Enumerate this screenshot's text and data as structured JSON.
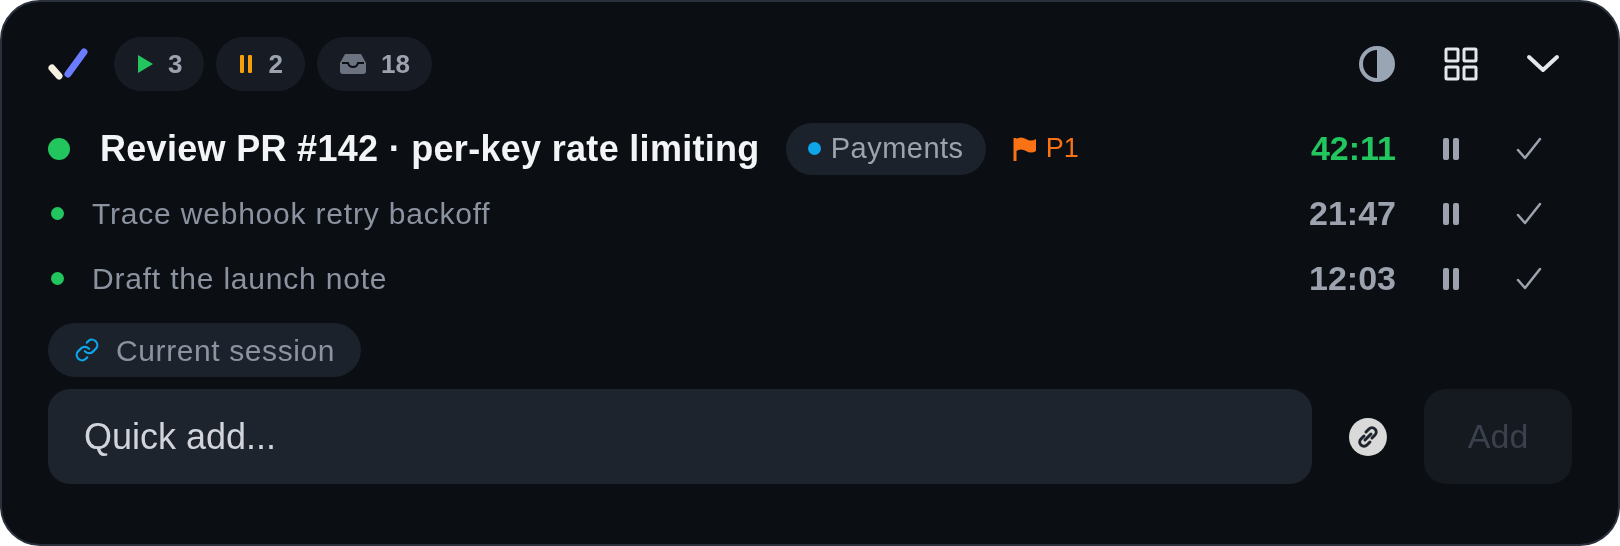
{
  "header": {
    "counters": [
      {
        "kind": "running",
        "count": "3"
      },
      {
        "kind": "paused",
        "count": "2"
      },
      {
        "kind": "inbox",
        "count": "18"
      }
    ]
  },
  "tasks": [
    {
      "title": "Review PR #142 · per-key rate limiting",
      "active": true,
      "tag": {
        "label": "Payments",
        "color": "#0ea5e9"
      },
      "priority": "P1",
      "time": "42:11"
    },
    {
      "title": "Trace webhook retry backoff",
      "active": false,
      "time": "21:47"
    },
    {
      "title": "Draft the launch note",
      "active": false,
      "time": "12:03"
    }
  ],
  "session_chip": {
    "label": "Current session"
  },
  "quick_add": {
    "placeholder": "Quick add...",
    "add_button": {
      "label": "Add",
      "disabled": true
    }
  }
}
